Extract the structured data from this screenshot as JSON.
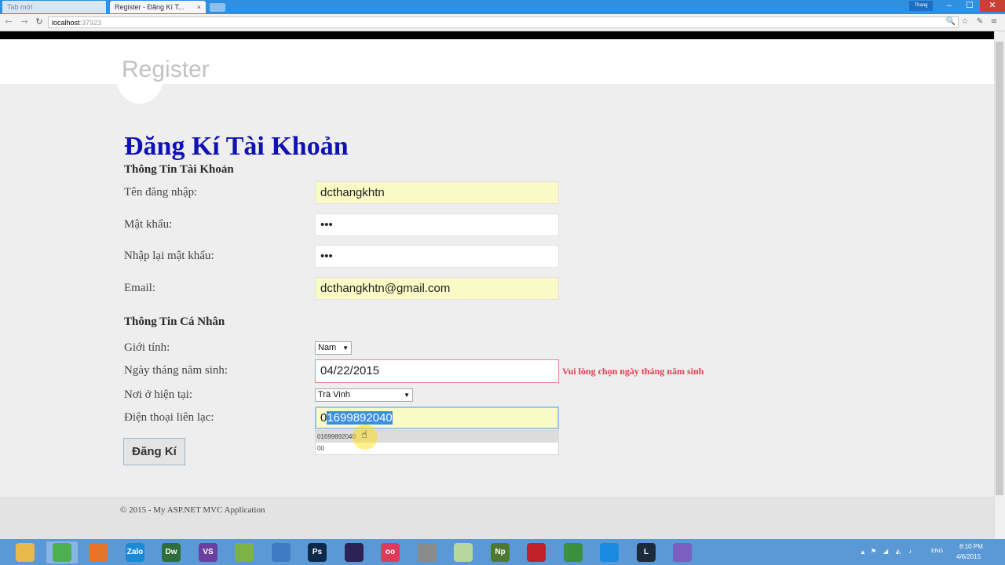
{
  "browser": {
    "tabs": [
      {
        "label": "Tab mới"
      },
      {
        "label": "Register - Đăng Kí T..."
      }
    ],
    "user_badge": "Thang",
    "url_host": "localhost",
    "url_port": ":37923"
  },
  "page": {
    "logo": "Register",
    "heading": "Đăng Kí Tài Khoản",
    "account_section": "Thông Tin Tài Khoản",
    "personal_section": "Thông Tin Cá Nhân",
    "fields": {
      "username": {
        "label": "Tên đăng nhập:",
        "value": "dcthangkhtn"
      },
      "password": {
        "label": "Mật khẩu:",
        "value": "•••"
      },
      "confirm_password": {
        "label": "Nhập lại mật khẩu:",
        "value": "•••"
      },
      "email": {
        "label": "Email:",
        "value": "dcthangkhtn@gmail.com"
      },
      "gender": {
        "label": "Giới tính:",
        "value": "Nam"
      },
      "dob": {
        "label": "Ngày tháng năm sinh:",
        "value": "04/22/2015",
        "error": "Vui lòng chọn ngày tháng năm sinh"
      },
      "residence": {
        "label": "Nơi ở hiện tại:",
        "value": "Trà Vinh"
      },
      "phone": {
        "label": "Điện thoại liên lạc:",
        "value_first": "0",
        "value_selected": "1699892040"
      }
    },
    "autocomplete": [
      "01699892040",
      "00"
    ],
    "submit_label": "Đăng Kí",
    "footer": "© 2015 - My ASP.NET MVC Application"
  },
  "taskbar": {
    "apps": [
      {
        "name": "file-explorer-icon",
        "label": "",
        "color": "#e9b949"
      },
      {
        "name": "chrome-icon",
        "label": "",
        "color": "#4caf50"
      },
      {
        "name": "firefox-icon",
        "label": "",
        "color": "#e8742a"
      },
      {
        "name": "zalo-icon",
        "label": "Zalo",
        "color": "#1a8ad6"
      },
      {
        "name": "dreamweaver-icon",
        "label": "Dw",
        "color": "#2f6e3a"
      },
      {
        "name": "visual-studio-icon",
        "label": "VS",
        "color": "#6a3fa0"
      },
      {
        "name": "android-studio-icon",
        "label": "",
        "color": "#7cb342"
      },
      {
        "name": "virtualbox-icon",
        "label": "",
        "color": "#3e7bc4"
      },
      {
        "name": "photoshop-icon",
        "label": "Ps",
        "color": "#0b2a4a"
      },
      {
        "name": "eclipse-icon",
        "label": "",
        "color": "#2c2255"
      },
      {
        "name": "app-oo-icon",
        "label": "oo",
        "color": "#e03a5a"
      },
      {
        "name": "package-icon",
        "label": "",
        "color": "#8a8a8a"
      },
      {
        "name": "folder-icon",
        "label": "",
        "color": "#b7d7a0"
      },
      {
        "name": "notepad-icon",
        "label": "Np",
        "color": "#4f7a2e"
      },
      {
        "name": "game-icon",
        "label": "",
        "color": "#c0202a"
      },
      {
        "name": "media-icon",
        "label": "",
        "color": "#3c8f3c"
      },
      {
        "name": "teamviewer-icon",
        "label": "",
        "color": "#1a8ae0"
      },
      {
        "name": "league-icon",
        "label": "L",
        "color": "#1c2a3a"
      },
      {
        "name": "browser-alt-icon",
        "label": "",
        "color": "#7a5fc0"
      }
    ],
    "language": "ENG",
    "time": "8:10 PM",
    "date": "4/6/2015"
  }
}
